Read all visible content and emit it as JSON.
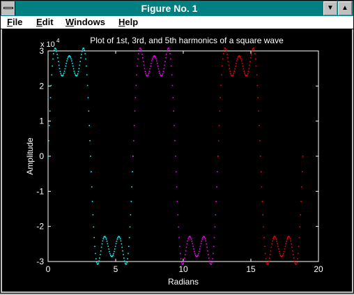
{
  "window": {
    "title": "Figure No. 1"
  },
  "titlebar": {
    "min_icon": "▼",
    "max_icon": "▲"
  },
  "menu": [
    {
      "label": "File",
      "accel": "F",
      "rest": "ile"
    },
    {
      "label": "Edit",
      "accel": "E",
      "rest": "dit"
    },
    {
      "label": "Windows",
      "accel": "W",
      "rest": "indows"
    },
    {
      "label": "Help",
      "accel": "H",
      "rest": "elp"
    }
  ],
  "colors": {
    "titlebar": "#008080",
    "plot_bg": "#000000",
    "axis": "#ffffff"
  },
  "chart_data": {
    "type": "line",
    "title": "Plot of 1st, 3rd, and 5th harmonics of a square wave",
    "xlabel": "Radians",
    "ylabel": "Amplitude",
    "xlim": [
      0,
      20
    ],
    "ylim": [
      -3,
      3
    ],
    "y_multiplier": "x 10",
    "y_exponent": "4",
    "xticks": [
      "0",
      "5",
      "10",
      "15",
      "20"
    ],
    "yticks": [
      "-3",
      "-2",
      "-1",
      "0",
      "1",
      "2",
      "3"
    ],
    "grid": false,
    "marker": "dots",
    "series": [
      {
        "color": "#00ffff",
        "x_range": [
          0,
          6.2832
        ],
        "formula": "3.3*(sin x + sin 3x/3 + sin 5x/5)"
      },
      {
        "color": "#ff00ff",
        "x_range": [
          6.2832,
          12.5664
        ],
        "formula": "3.3*(sin x + sin 3x/3 + sin 5x/5)"
      },
      {
        "color": "#ff0000",
        "x_range": [
          12.5664,
          18.8496
        ],
        "formula": "3.3*(sin x + sin 3x/3 + sin 5x/5)"
      }
    ]
  }
}
